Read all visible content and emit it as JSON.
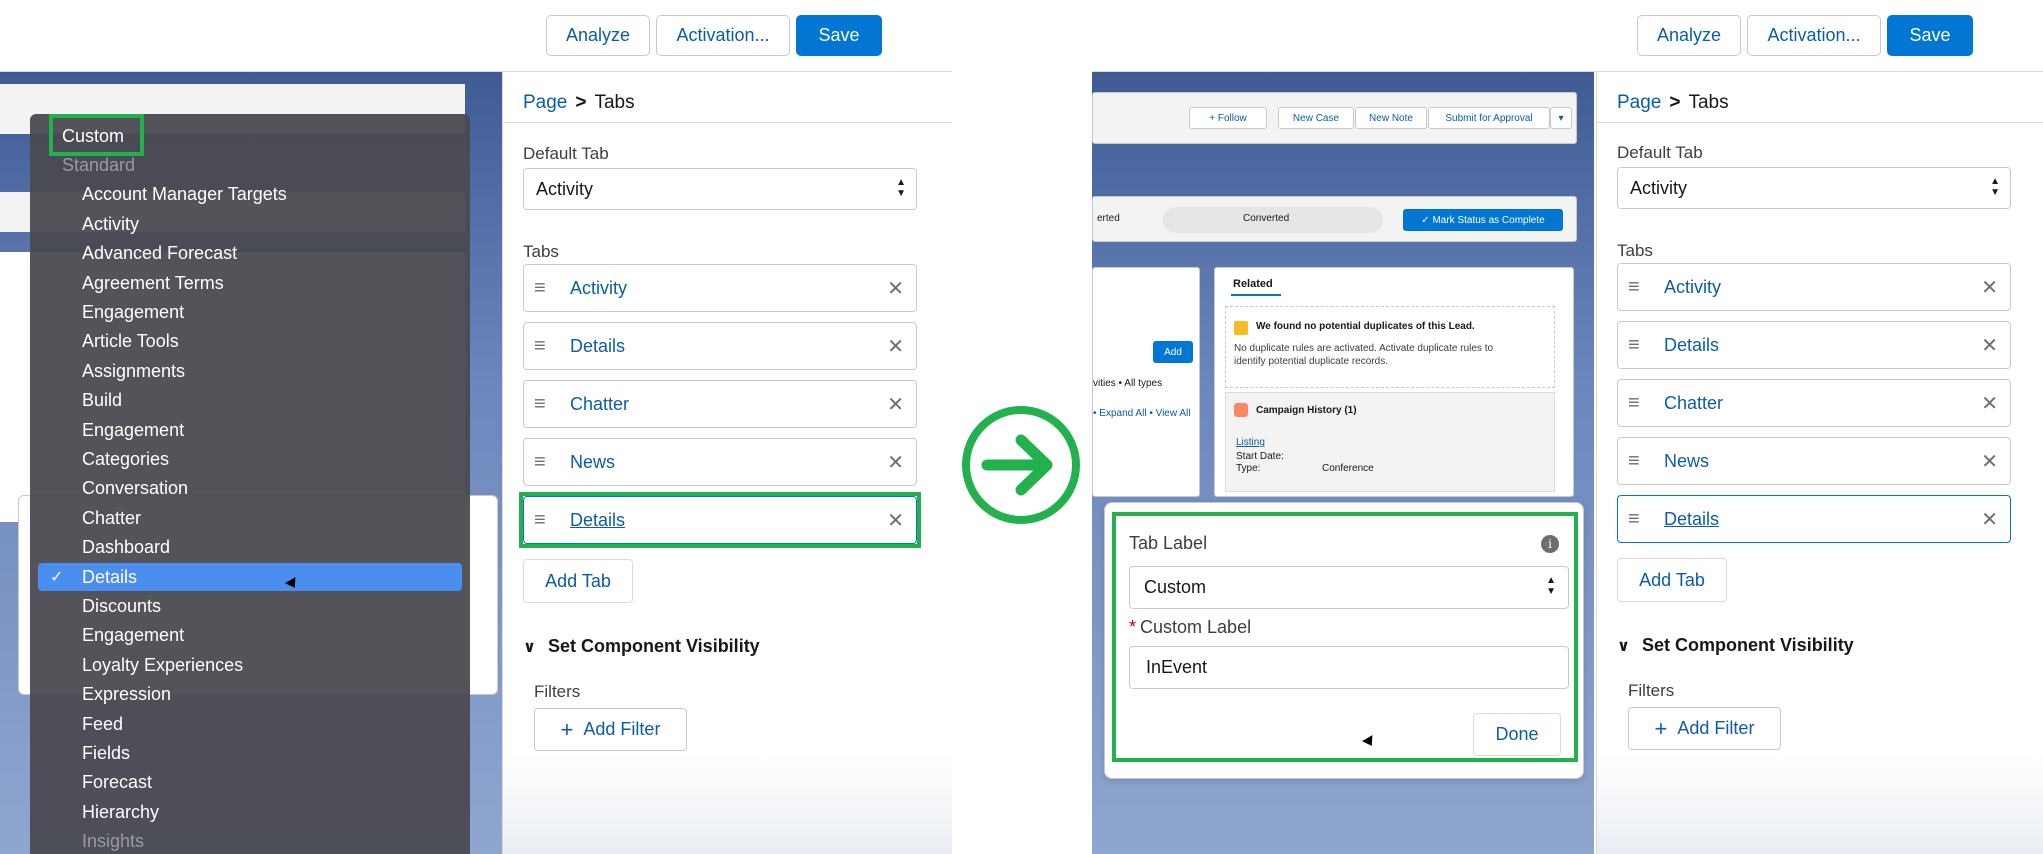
{
  "toolbar": {
    "analyze_label": "Analyze",
    "activation_label": "Activation...",
    "save_label": "Save"
  },
  "breadcrumb": {
    "page": "Page",
    "separator": ">",
    "current": "Tabs"
  },
  "properties": {
    "default_tab_label": "Default Tab",
    "default_tab_value": "Activity",
    "tabs_label": "Tabs",
    "tabs": [
      "Activity",
      "Details",
      "Chatter",
      "News",
      "Details"
    ],
    "add_tab_label": "Add Tab",
    "visibility_label": "Set Component Visibility",
    "filters_label": "Filters",
    "add_filter_label": "Add Filter"
  },
  "dropdown": {
    "items": [
      {
        "label": "Custom",
        "kind": "group"
      },
      {
        "label": "Standard",
        "kind": "group-dim"
      },
      {
        "label": "Account Manager Targets"
      },
      {
        "label": "Activity"
      },
      {
        "label": "Advanced Forecast"
      },
      {
        "label": "Agreement Terms"
      },
      {
        "label": "Engagement"
      },
      {
        "label": "Article Tools"
      },
      {
        "label": "Assignments"
      },
      {
        "label": "Build"
      },
      {
        "label": "Engagement"
      },
      {
        "label": "Categories"
      },
      {
        "label": "Conversation"
      },
      {
        "label": "Chatter"
      },
      {
        "label": "Dashboard"
      },
      {
        "label": "Details",
        "selected": true
      },
      {
        "label": "Discounts"
      },
      {
        "label": "Engagement"
      },
      {
        "label": "Loyalty Experiences"
      },
      {
        "label": "Expression"
      },
      {
        "label": "Feed"
      },
      {
        "label": "Fields"
      },
      {
        "label": "Forecast"
      },
      {
        "label": "Hierarchy"
      },
      {
        "label": "Insights",
        "dim": true
      }
    ]
  },
  "popover": {
    "tab_label_title": "Tab Label",
    "tab_label_value": "Custom",
    "required_marker": "*",
    "custom_label_title": "Custom Label",
    "custom_label_value": "InEvent",
    "done_label": "Done"
  },
  "canvas_right": {
    "follow": "+ Follow",
    "new_case": "New Case",
    "new_note": "New Note",
    "submit": "Submit for Approval",
    "converted": "Converted",
    "mark_complete": "✓ Mark Status as Complete",
    "related": "Related",
    "dupes_title": "We found no potential duplicates of this Lead.",
    "dupes_body1": "No duplicate rules are activated. Activate duplicate rules to",
    "dupes_body2": "identify potential duplicate records.",
    "campaign": "Campaign History (1)",
    "listing": "Listing",
    "start_date": "Start Date:",
    "type": "Type:",
    "conference": "Conference",
    "add": "Add",
    "activities": "vities • All types",
    "expand": "• Expand All • View All",
    "verted": "erted"
  },
  "colors": {
    "brand_blue": "#0176d3",
    "link_blue": "#0b5cab",
    "highlight_green": "#22b14c",
    "dropdown_bg": "#4a4a50",
    "dropdown_selected": "#4a8ff0"
  }
}
